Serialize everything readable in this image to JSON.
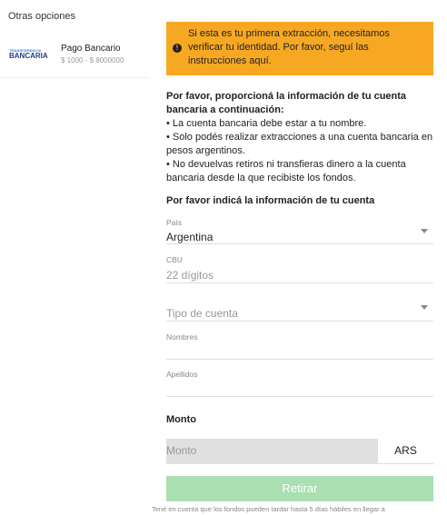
{
  "sidebar": {
    "title": "Otras opciones",
    "method": {
      "logo_line1": "TRANSFERENCIA",
      "logo_line2": "BANCARIA",
      "name": "Pago Bancario",
      "range": "$ 1000 - $ 8000000"
    }
  },
  "alert": {
    "icon": "exclamation-icon",
    "text": "Si esta es tu primera extracción, necesitamos verificar tu identidad. Por favor, seguí las instrucciones aquí.",
    "color": "#f7a823"
  },
  "info": {
    "heading": "Por favor, proporcioná la información de tu cuenta bancaria a continuación:",
    "bullets": [
      "• La cuenta bancaria debe estar a tu nombre.",
      "• Solo podés realizar extracciones a una cuenta bancaria en pesos argentinos.",
      "• No devuelvas retiros ni transfieras dinero a la cuenta bancaria desde la que recibiste los fondos."
    ]
  },
  "form": {
    "section_title": "Por favor indicá la información de tu cuenta",
    "country": {
      "label": "País",
      "value": "Argentina"
    },
    "cbu": {
      "label": "CBU",
      "placeholder": "22 dígitos"
    },
    "account_type": {
      "placeholder": "Tipo de cuenta"
    },
    "first_name": {
      "label": "Nombres"
    },
    "last_name": {
      "label": "Apellidos"
    }
  },
  "amount": {
    "title": "Monto",
    "placeholder": "Monto",
    "currency": "ARS"
  },
  "submit": {
    "label": "Retirar",
    "color": "#aadfb1"
  },
  "footnote": "Tené en cuenta que los fondos pueden tardar hasta 5 días hábiles en llegar a"
}
